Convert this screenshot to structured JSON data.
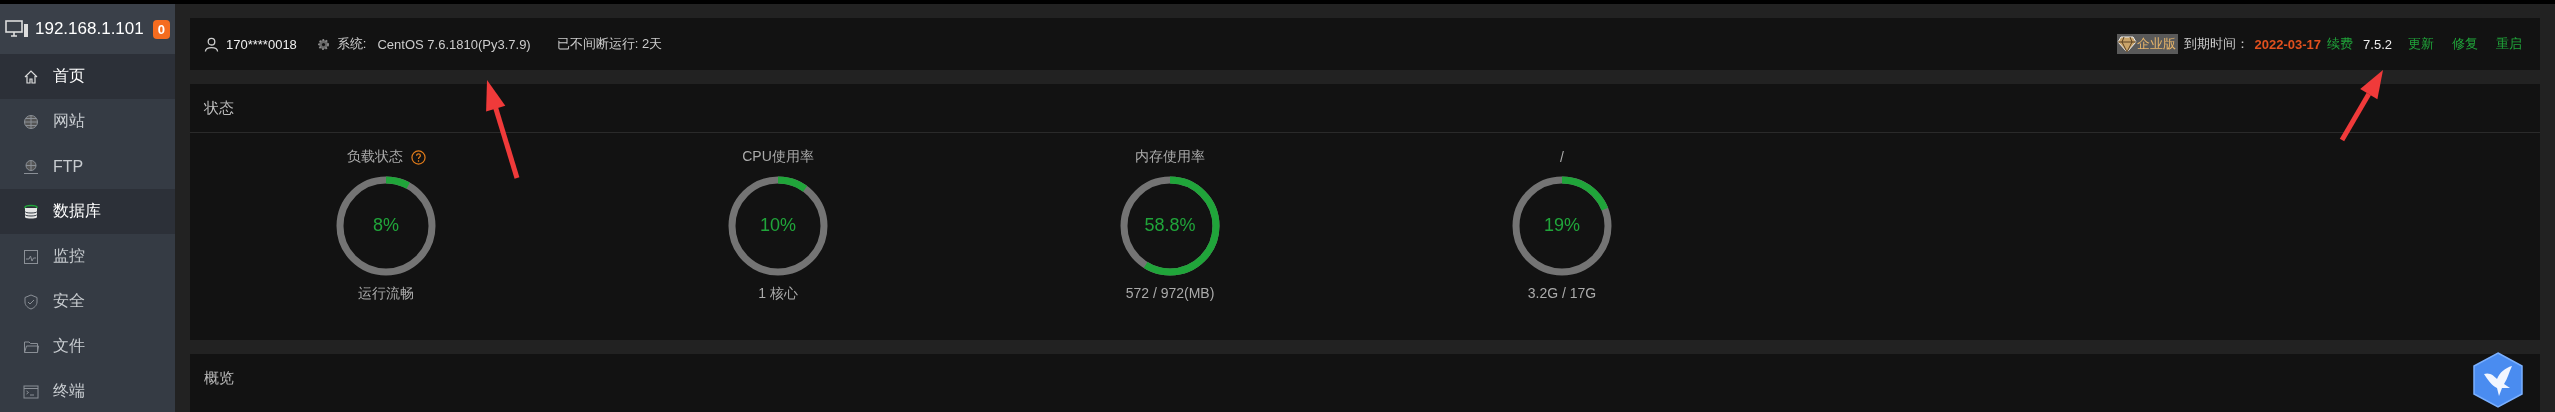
{
  "sidebar": {
    "host": "192.168.1.101",
    "badge": "0",
    "items": [
      {
        "label": "首页",
        "selected": true
      },
      {
        "label": "网站",
        "selected": false
      },
      {
        "label": "FTP",
        "selected": false
      },
      {
        "label": "数据库",
        "selected": true
      },
      {
        "label": "监控",
        "selected": false
      },
      {
        "label": "安全",
        "selected": false
      },
      {
        "label": "文件",
        "selected": false
      },
      {
        "label": "终端",
        "selected": false
      }
    ]
  },
  "top_bar": {
    "user": "170****0018",
    "system_label": "系统:",
    "system_value": "CentOS 7.6.1810(Py3.7.9)",
    "uptime": "已不间断运行: 2天",
    "edition": "企业版",
    "expiry_label": "到期时间：",
    "expiry_date": "2022-03-17",
    "renew": "续费",
    "version": "7.5.2",
    "actions": [
      "更新",
      "修复",
      "重启"
    ]
  },
  "status": {
    "title": "状态",
    "gauges": [
      {
        "title": "负载状态",
        "help": true,
        "value": "8%",
        "level": 0.08,
        "caption": "运行流畅"
      },
      {
        "title": "CPU使用率",
        "help": false,
        "value": "10%",
        "level": 0.1,
        "caption": "1 核心"
      },
      {
        "title": "内存使用率",
        "help": false,
        "value": "58.8%",
        "level": 0.588,
        "caption": "572 / 972(MB)"
      },
      {
        "title": "/",
        "help": false,
        "value": "19%",
        "level": 0.19,
        "caption": "3.2G / 17G"
      }
    ]
  },
  "overview": {
    "title": "概览"
  }
}
